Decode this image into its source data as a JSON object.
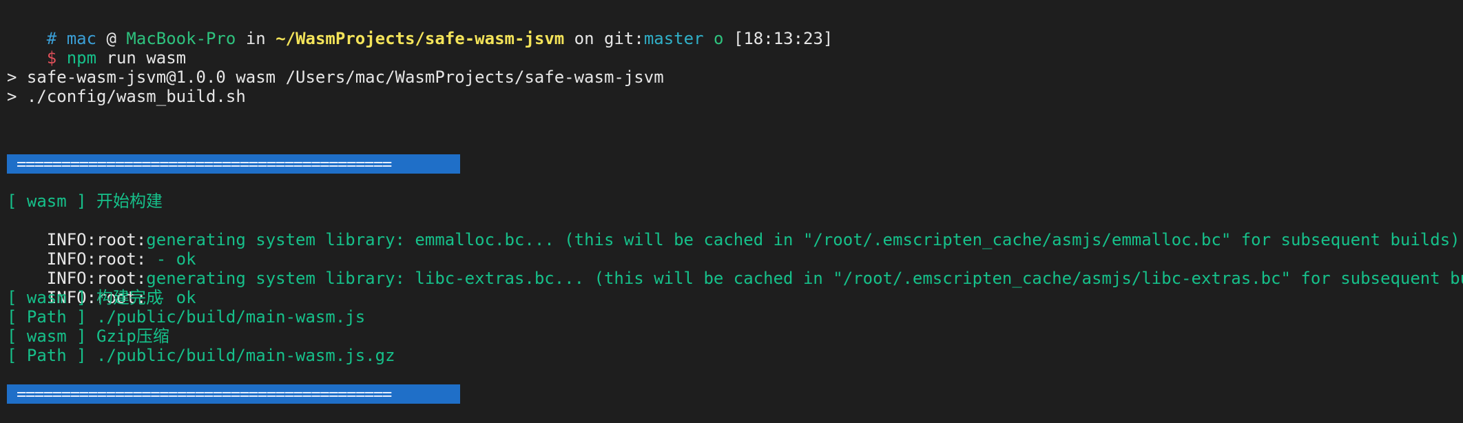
{
  "prompt": {
    "hash": "#",
    "user": "mac",
    "at": "@",
    "host": "MacBook-Pro",
    "in": "in",
    "path": "~/WasmProjects/safe-wasm-jsvm",
    "on": "on",
    "git_prefix": "git:",
    "branch": "master",
    "status": "o",
    "time": "[18:13:23]"
  },
  "command": {
    "dollar": "$",
    "bin": "npm",
    "args": "run wasm"
  },
  "npm_output": [
    "> safe-wasm-jsvm@1.0.0 wasm /Users/mac/WasmProjects/safe-wasm-jsvm",
    "> ./config/wasm_build.sh"
  ],
  "separator": "==========================================",
  "build_log": {
    "start": "[ wasm ] 开始构建",
    "info1_prefix": "INFO:root:",
    "info1_msg": "generating system library: emmalloc.bc... (this will be cached in \"/root/.emscripten_cache/asmjs/emmalloc.bc\" for subsequent builds)",
    "ok1_prefix": "INFO:root:",
    "ok1_msg": " - ok",
    "info2_prefix": "INFO:root:",
    "info2_msg": "generating system library: libc-extras.bc... (this will be cached in \"/root/.emscripten_cache/asmjs/libc-extras.bc\" for subsequent builds)",
    "ok2_prefix": "INFO:root:",
    "ok2_msg": " - ok",
    "done": "[ wasm ] 构建完成",
    "path1": "[ Path ] ./public/build/main-wasm.js",
    "gzip": "[ wasm ] Gzip压缩",
    "path2": "[ Path ] ./public/build/main-wasm.js.gz"
  },
  "colors": {
    "background": "#1e1e1e",
    "prompt_user": "#3b9fd6",
    "host": "#2ec27e",
    "path": "#f4e45a",
    "branch": "#30b0c8",
    "dollar": "#e0505a",
    "log_green": "#16c08a",
    "separator_bg": "#1f6fc8"
  }
}
